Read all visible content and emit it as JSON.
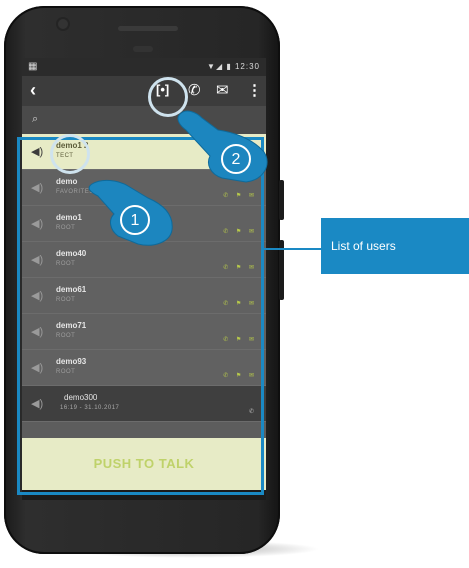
{
  "statusbar": {
    "time": "12:30",
    "indicators": "▼◢ ▮",
    "left_icon": "▦"
  },
  "appbar": {
    "back_icon": "‹",
    "ptt_icon": "[•]",
    "call_icon": "✆",
    "mail_icon": "✉",
    "more_icon": "⋮"
  },
  "search": {
    "icon": "⌕"
  },
  "users": [
    {
      "name": "demo1 2",
      "sub": "ТЕСТ",
      "actions": "",
      "selected": true
    },
    {
      "name": "demo",
      "sub": "FAVORITES",
      "actions": "✆ ⚑ ✉"
    },
    {
      "name": "demo1",
      "sub": "ROOT",
      "actions": "✆ ⚑ ✉"
    },
    {
      "name": "demo40",
      "sub": "ROOT",
      "actions": "✆ ⚑ ✉"
    },
    {
      "name": "demo61",
      "sub": "ROOT",
      "actions": "✆ ⚑ ✉"
    },
    {
      "name": "demo71",
      "sub": "ROOT",
      "actions": "✆ ⚑ ✉"
    },
    {
      "name": "demo93",
      "sub": "ROOT",
      "actions": "✆ ⚑ ✉"
    },
    {
      "name": "demo300",
      "sub": "16:19 - 31.10.2017",
      "actions": "✆",
      "dark": true
    }
  ],
  "ptt_label": "PUSH TO TALK",
  "callout_label": "List of users",
  "badges": {
    "one": "1",
    "two": "2"
  },
  "accent": "#1a89c4"
}
